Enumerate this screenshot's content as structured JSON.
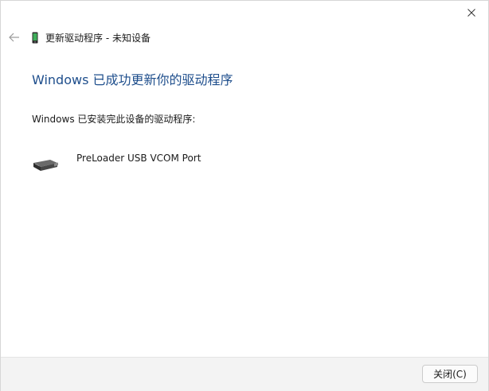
{
  "window": {
    "title": "更新驱动程序 - 未知设备"
  },
  "content": {
    "heading": "Windows 已成功更新你的驱动程序",
    "subtext": "Windows 已安装完此设备的驱动程序:",
    "device_name": "PreLoader USB VCOM Port"
  },
  "footer": {
    "close_label": "关闭(C)"
  },
  "icons": {
    "close": "close-icon",
    "back": "back-arrow-icon",
    "title_device": "phone-device-icon",
    "device": "usb-port-device-icon"
  },
  "colors": {
    "heading": "#1e4e8c",
    "footer_bg": "#f3f3f3"
  }
}
